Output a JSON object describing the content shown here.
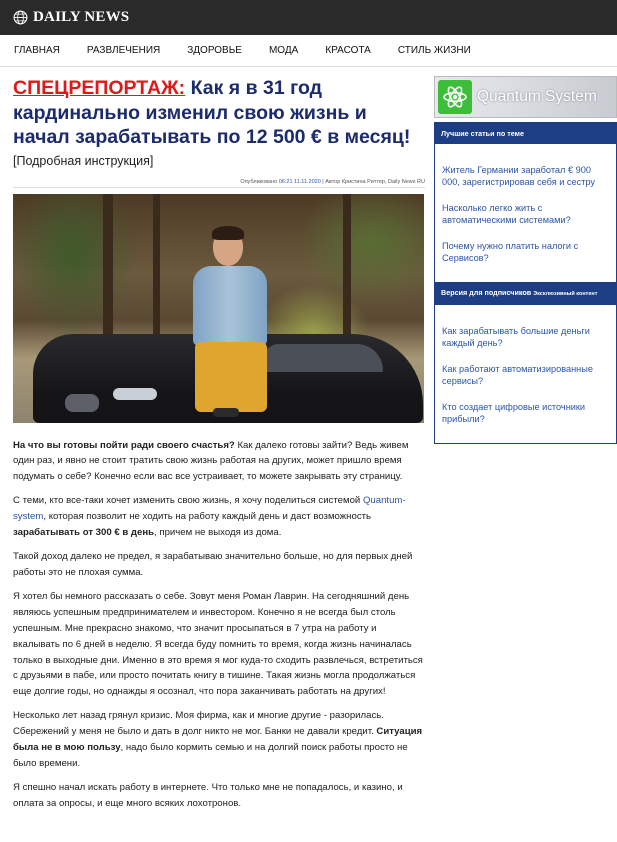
{
  "header": {
    "logo_text": "DAILY NEWS"
  },
  "nav": [
    "ГЛАВНАЯ",
    "РАЗВЛЕЧЕНИЯ",
    "ЗДОРОВЬЕ",
    "МОДА",
    "КРАСОТА",
    "СТИЛЬ ЖИЗНИ"
  ],
  "article": {
    "kicker": "СПЕЦРЕПОРТАЖ:",
    "title": "Как я в 31 год кардинально изменил свою жизнь и начал зарабатывать по 12 500 € в месяц!",
    "subtitle": "[Подробная инструкция]",
    "byline_prefix": "Опубликовано",
    "byline_time": "06:21 11.11.2020",
    "byline_suffix": "| Автор Кристина Риттер, Daily News RU",
    "p1_bold": "На что вы готовы пойти ради своего счастья?",
    "p1_rest": " Как далеко готовы зайти? Ведь живем один раз, и явно не стоит тратить свою жизнь работая на других, может пришло время подумать о себе? Конечно если вас все устраивает, то можете закрывать эту страницу.",
    "p2_a": "С теми, кто все-таки хочет изменить свою жизнь, я хочу поделиться системой ",
    "p2_link": "Quantum-system",
    "p2_b": ", которая позволит не ходить на работу каждый день и даст возможность ",
    "p2_bold": "зарабатывать от 300 € в день",
    "p2_c": ", причем не выходя из дома.",
    "p3": "Такой доход далеко не предел, я зарабатываю значительно больше, но для первых дней работы это не плохая сумма.",
    "p4": "Я хотел бы немного рассказать о себе. Зовут меня Роман Лаврин. На сегодняшний день являюсь успешным предпринимателем и инвестором. Конечно я не всегда был столь успешным. Мне прекрасно знакомо, что значит просыпаться в 7 утра на работу и вкалывать по 6 дней в неделю. Я всегда буду помнить то время, когда жизнь начиналась только в выходные дни. Именно в это время я мог куда-то сходить развлечься, встретиться с друзьями в пабе, или просто почитать книгу в тишине. Такая жизнь могла продолжаться еще долгие годы, но однажды я осознал, что пора заканчивать работать на других!",
    "p5_a": "Несколько лет назад грянул кризис. Моя фирма, как и многие другие - разорилась. Сбережений у меня не было и дать в долг никто не мог. Банки не давали кредит. ",
    "p5_bold": "Ситуация была не в мою пользу",
    "p5_b": ", надо было кормить семью и на долгий поиск работы просто не было времени.",
    "p6": "Я спешно начал искать работу в интернете. Что только мне не попадалось, и казино, и оплата за опросы, и еще много всяких лохотронов."
  },
  "sidebar": {
    "banner_text": "Quantum System",
    "box1_title": "Лучшие статьи по теме",
    "box1_items": [
      "Житель Германии заработал € 900 000, зарегистрировав себя и сестру",
      "Насколько легко жить с автоматическими системами?",
      "Почему нужно платить налоги с Сервисов?"
    ],
    "box2_title": "Версия для подписчиков",
    "box2_title_small": "Эксклюзивный контент",
    "box2_items": [
      "Как зарабатывать большие деньги каждый день?",
      "Как работают автоматизированные сервисы?",
      "Кто создает цифровые источники прибыли?"
    ]
  },
  "colors": {
    "topbar": "#2a2a2a",
    "headline": "#1b2b6b",
    "kicker": "#e01818",
    "link": "#2c55a8",
    "sidebar_head": "#1d3e84"
  },
  "icons": [
    "globe-icon",
    "quantum-logo-icon"
  ]
}
